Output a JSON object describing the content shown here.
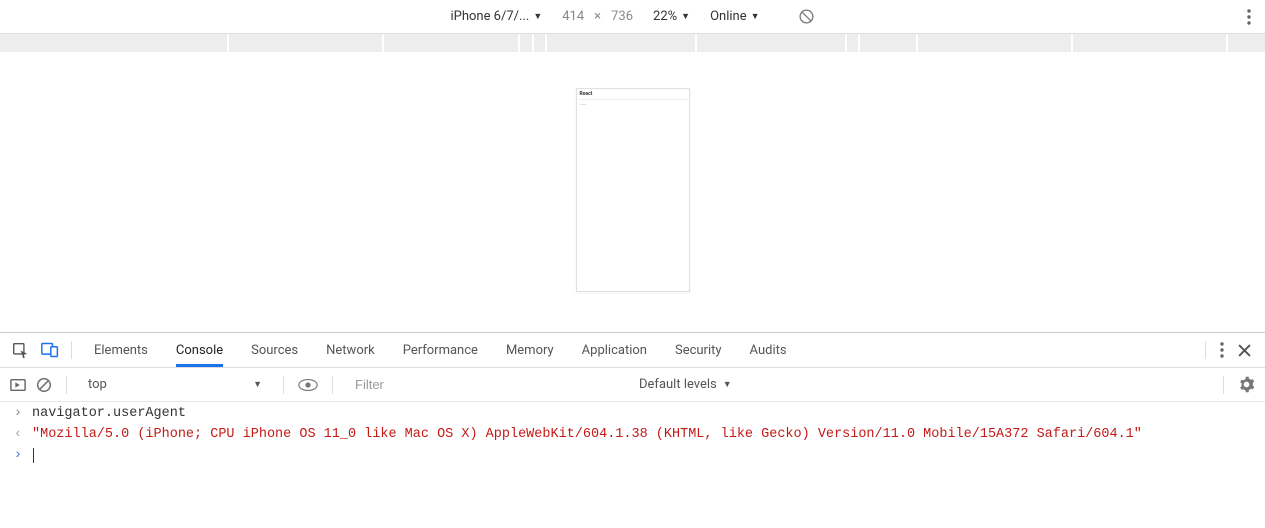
{
  "deviceBar": {
    "deviceName": "iPhone 6/7/...",
    "width": "414",
    "height": "736",
    "dimSep": "×",
    "zoom": "22%",
    "throttling": "Online"
  },
  "deviceFrame": {
    "title": "React",
    "sub": "......"
  },
  "tabs": {
    "items": [
      "Elements",
      "Console",
      "Sources",
      "Network",
      "Performance",
      "Memory",
      "Application",
      "Security",
      "Audits"
    ],
    "activeIndex": 1
  },
  "consoleToolbar": {
    "context": "top",
    "filterPlaceholder": "Filter",
    "levels": "Default levels"
  },
  "console": {
    "inputLine": "navigator.userAgent",
    "outputLine": "\"Mozilla/5.0 (iPhone; CPU iPhone OS 11_0 like Mac OS X) AppleWebKit/604.1.38 (KHTML, like Gecko) Version/11.0 Mobile/15A372 Safari/604.1\"",
    "promptValue": ""
  },
  "ruler": {
    "segments": [
      245,
      165,
      145,
      12,
      12,
      160,
      160,
      12,
      60,
      165,
      165,
      40
    ]
  }
}
